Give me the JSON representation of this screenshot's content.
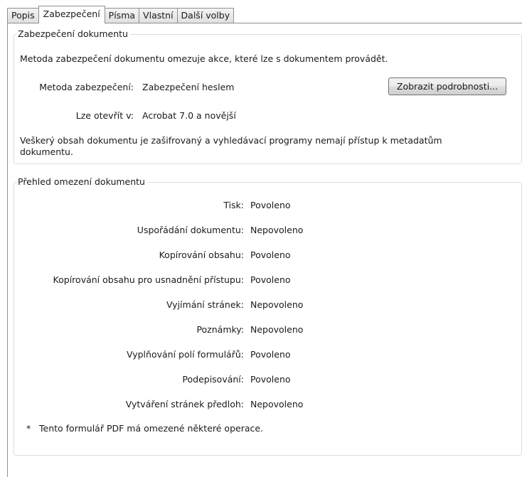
{
  "tabs": [
    {
      "label": "Popis",
      "active": false
    },
    {
      "label": "Zabezpečení",
      "active": true
    },
    {
      "label": "Písma",
      "active": false
    },
    {
      "label": "Vlastní",
      "active": false
    },
    {
      "label": "Další volby",
      "active": false
    }
  ],
  "security": {
    "group_title": "Zabezpečení dokumentu",
    "description": "Metoda zabezpečení dokumentu omezuje akce, které lze s dokumentem provádět.",
    "method_label": "Metoda zabezpečení:",
    "method_value": "Zabezpečení heslem",
    "details_button": "Zobrazit podrobnosti...",
    "open_label": "Lze otevřít v:",
    "open_value": "Acrobat 7.0 a novější",
    "encryption_note_line1": "Veškerý obsah dokumentu je zašifrovaný a vyhledávací programy nemají přístup k metadatům",
    "encryption_note_line2": "dokumentu."
  },
  "restrictions": {
    "group_title": "Přehled omezení dokumentu",
    "rows": [
      {
        "label": "Tisk:",
        "value": "Povoleno"
      },
      {
        "label": "Uspořádání dokumentu:",
        "value": "Nepovoleno"
      },
      {
        "label": "Kopírování obsahu:",
        "value": "Povoleno"
      },
      {
        "label": "Kopírování obsahu pro usnadnění přístupu:",
        "value": "Povoleno"
      },
      {
        "label": "Vyjímání stránek:",
        "value": "Nepovoleno"
      },
      {
        "label": "Poznámky:",
        "value": "Nepovoleno"
      },
      {
        "label": "Vyplňování polí formulářů:",
        "value": "Povoleno"
      },
      {
        "label": "Podepisování:",
        "value": "Povoleno"
      },
      {
        "label": "Vytváření stránek předloh:",
        "value": "Nepovoleno"
      }
    ],
    "footnote_star": "*",
    "footnote": "Tento formulář PDF má omezené některé operace."
  }
}
